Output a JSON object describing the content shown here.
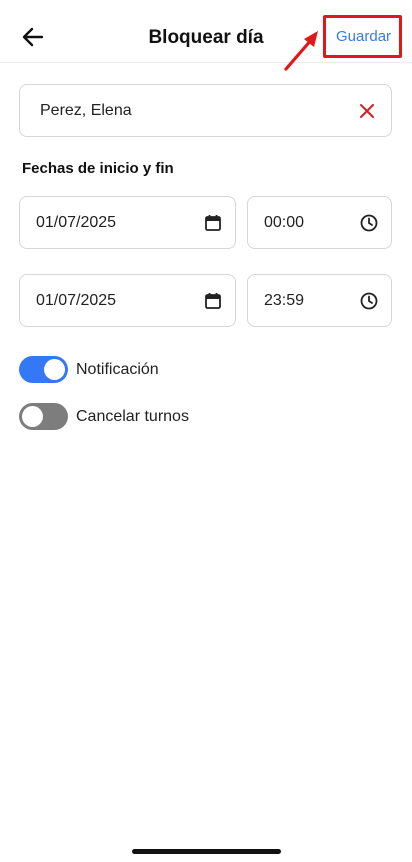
{
  "header": {
    "title": "Bloquear día",
    "save_label": "Guardar",
    "highlight_color": "#e11818"
  },
  "employee": {
    "value": "Perez, Elena"
  },
  "dates_section": {
    "title": "Fechas de inicio y fin",
    "start_date": "01/07/2025",
    "start_time": "00:00",
    "end_date": "01/07/2025",
    "end_time": "23:59"
  },
  "toggles": [
    {
      "label": "Notificación",
      "state": "on"
    },
    {
      "label": "Cancelar turnos",
      "state": "off"
    }
  ],
  "colors": {
    "accent": "#3a7be0",
    "toggle_on": "#3478f6",
    "toggle_off": "#7d7d7d",
    "clear": "#d32020"
  },
  "icons": [
    "arrow-left-icon",
    "close-icon",
    "calendar-icon",
    "clock-icon"
  ]
}
